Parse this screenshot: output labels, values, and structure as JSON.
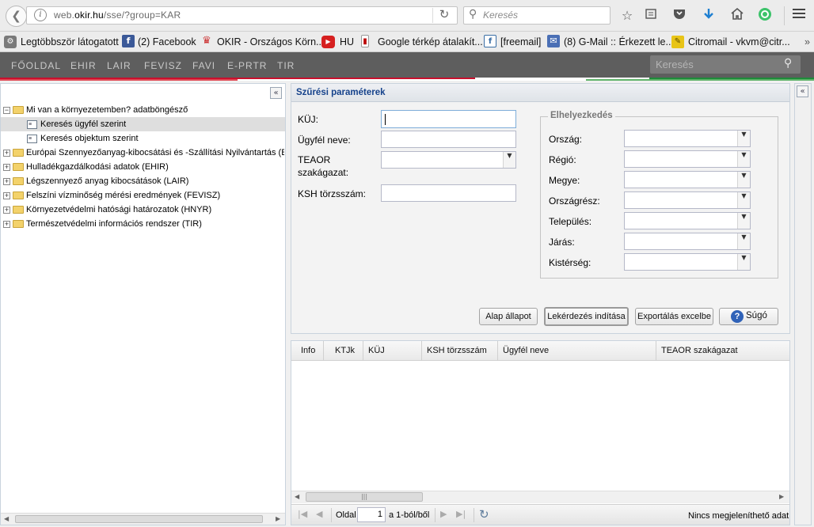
{
  "browser": {
    "url_prefix": "web.",
    "url_domain": "okir.hu",
    "url_suffix": "/sse/?group=KAR",
    "search_placeholder": "Keresés",
    "icons": [
      "back-icon",
      "info-icon",
      "reload-icon",
      "search-icon",
      "star-icon",
      "reading-list-icon",
      "pocket-icon",
      "download-icon",
      "home-icon",
      "extension-icon",
      "menu-icon"
    ]
  },
  "bookmarks": [
    {
      "label": "Legtöbbször látogatott",
      "icon": "gear-bookmark-icon"
    },
    {
      "label": "(2) Facebook",
      "icon": "facebook-icon"
    },
    {
      "label": "OKIR - Országos Körn...",
      "icon": "okir-icon"
    },
    {
      "label": "HU",
      "icon": "youtube-icon"
    },
    {
      "label": "Google térkép átalakít...",
      "icon": "bookmark-icon"
    },
    {
      "label": "[freemail]",
      "icon": "freemail-icon"
    },
    {
      "label": "(8) G-Mail :: Érkezett le...",
      "icon": "mail-icon"
    },
    {
      "label": "Citromail - vkvm@citr...",
      "icon": "citromail-icon"
    }
  ],
  "bookmarks_more": "»",
  "site_nav": {
    "items": [
      "FŐOLDAL",
      "EHIR",
      "LAIR",
      "FEVISZ",
      "FAVI",
      "E-PRTR",
      "TIR"
    ],
    "search_placeholder": "Keresés"
  },
  "tree": {
    "root": "Mi van a környezetemben? adatböngésző",
    "children": [
      "Keresés ügyfél szerint",
      "Keresés objektum szerint"
    ],
    "nodes": [
      "Európai Szennyezőanyag-kibocsátási és -Szállítási Nyilvántartás (E",
      "Hulladékgazdálkodási adatok (EHIR)",
      "Légszennyező anyag kibocsátások (LAIR)",
      "Felszíni vízminőség mérési eredmények (FEVISZ)",
      "Környezetvédelmi hatósági határozatok (HNYR)",
      "Természetvédelmi információs rendszer (TIR)"
    ],
    "collapse_icon": "«"
  },
  "filter": {
    "title": "Szűrési paraméterek",
    "kuj_label": "KÜJ:",
    "client_label": "Ügyfél neve:",
    "teaor_label_1": "TEAOR",
    "teaor_label_2": "szakágazat:",
    "ksh_label": "KSH törzsszám:",
    "location": {
      "legend": "Elhelyezkedés",
      "fields": [
        "Ország:",
        "Régió:",
        "Megye:",
        "Országrész:",
        "Település:",
        "Járás:",
        "Kistérség:"
      ]
    },
    "buttons": {
      "reset": "Alap állapot",
      "query": "Lekérdezés indítása",
      "export": "Exportálás excelbe",
      "help": "Súgó"
    }
  },
  "grid": {
    "columns": [
      "Info",
      "KTJk",
      "KÜJ",
      "KSH törzsszám",
      "Ügyfél neve",
      "TEAOR szakágazat"
    ],
    "pager": {
      "page_label": "Oldal",
      "page_value": "1",
      "of_label": "a 1-ból/ből",
      "status": "Nincs megjeleníthető adat"
    }
  }
}
